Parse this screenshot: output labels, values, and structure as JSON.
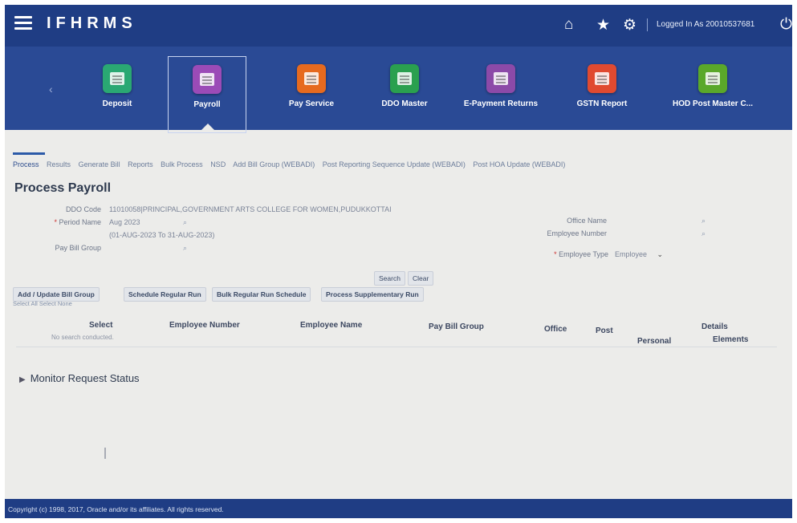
{
  "header": {
    "title": "IFHRMS",
    "logged_in": "Logged In As 20010537681",
    "icons": [
      "hamburger-icon",
      "home-icon",
      "star-icon",
      "gear-icon",
      "power-icon"
    ]
  },
  "springboard": {
    "tiles": [
      {
        "label": "Deposit",
        "color": "#2aa873"
      },
      {
        "label": "Payroll",
        "color": "#9b4bb7"
      },
      {
        "label": "Pay Service",
        "color": "#e66a1f"
      },
      {
        "label": "DDO Master",
        "color": "#2aa04f"
      },
      {
        "label": "E-Payment Returns",
        "color": "#8c4aa8"
      },
      {
        "label": "GSTN Report",
        "color": "#e04a30"
      },
      {
        "label": "HOD Post Master C...",
        "color": "#5aa82a"
      }
    ]
  },
  "tabs": [
    "Process",
    "Results",
    "Generate Bill",
    "Reports",
    "Bulk Process",
    "NSD",
    "Add Bill Group (WEBADI)",
    "Post Reporting Sequence Update (WEBADI)",
    "Post HOA Update (WEBADI)"
  ],
  "page": {
    "title": "Process Payroll",
    "ddo_code_label": "DDO Code",
    "ddo_code_value": "11010058|PRINCIPAL,GOVERNMENT ARTS COLLEGE FOR WOMEN,PUDUKKOTTAI",
    "period_name_label": "Period Name",
    "period_name_value": "Aug 2023",
    "period_range": "(01-AUG-2023 To 31-AUG-2023)",
    "pay_bill_group_label": "Pay Bill Group",
    "office_name_label": "Office Name",
    "employee_number_label": "Employee Number",
    "employee_type_label": "Employee Type",
    "employee_type_value": "Employee",
    "search_label": "Search",
    "clear_label": "Clear"
  },
  "buttons": {
    "add_update": "Add / Update Bill Group",
    "schedule": "Schedule Regular Run",
    "bulk": "Bulk Regular Run Schedule",
    "supplementary": "Process Supplementary Run"
  },
  "select_links": "Select All Select None",
  "table": {
    "columns": [
      "Select",
      "Employee Number",
      "Employee Name",
      "Pay Bill Group",
      "Office",
      "Post",
      "Details",
      "Personal",
      "Elements"
    ],
    "empty_text": "No search conducted."
  },
  "monitor": "Monitor Request Status",
  "footer": "Copyright (c) 1998, 2017, Oracle and/or its affiliates. All rights reserved."
}
